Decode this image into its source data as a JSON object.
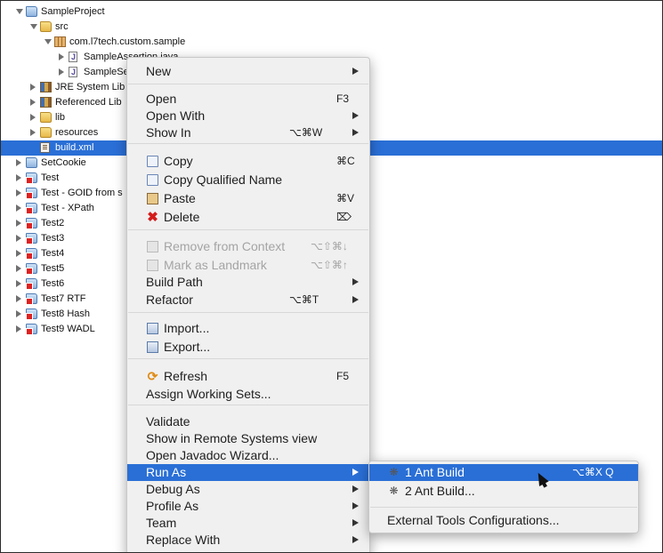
{
  "tree": [
    {
      "label": "SampleProject",
      "toggle": "open",
      "icon": "project-folder-icon"
    },
    {
      "label": "src",
      "toggle": "open",
      "icon": "source-folder-icon"
    },
    {
      "label": "com.l7tech.custom.sample",
      "toggle": "open",
      "icon": "package-icon"
    },
    {
      "label": "SampleAssertion.java",
      "toggle": "closed",
      "icon": "java-file-icon"
    },
    {
      "label": "SampleSe",
      "toggle": "closed",
      "icon": "java-file-icon"
    },
    {
      "label": "JRE System Lib",
      "toggle": "closed",
      "icon": "library-icon"
    },
    {
      "label": "Referenced Lib",
      "toggle": "closed",
      "icon": "library-icon"
    },
    {
      "label": "lib",
      "toggle": "closed",
      "icon": "folder-icon"
    },
    {
      "label": "resources",
      "toggle": "closed",
      "icon": "folder-icon"
    },
    {
      "label": "build.xml",
      "toggle": "none",
      "icon": "xml-file-icon",
      "selected": true
    },
    {
      "label": "SetCookie",
      "toggle": "closed",
      "icon": "project-folder-icon"
    },
    {
      "label": "Test",
      "toggle": "closed",
      "icon": "project-folder-icon",
      "error": true
    },
    {
      "label": "Test - GOID from s",
      "toggle": "closed",
      "icon": "project-folder-icon",
      "error": true
    },
    {
      "label": "Test - XPath",
      "toggle": "closed",
      "icon": "project-folder-icon",
      "error": true
    },
    {
      "label": "Test2",
      "toggle": "closed",
      "icon": "project-folder-icon",
      "error": true
    },
    {
      "label": "Test3",
      "toggle": "closed",
      "icon": "project-folder-icon",
      "error": true
    },
    {
      "label": "Test4",
      "toggle": "closed",
      "icon": "project-folder-icon",
      "error": true
    },
    {
      "label": "Test5",
      "toggle": "closed",
      "icon": "project-folder-icon",
      "error": true
    },
    {
      "label": "Test6",
      "toggle": "closed",
      "icon": "project-folder-icon",
      "error": true
    },
    {
      "label": "Test7 RTF",
      "toggle": "closed",
      "icon": "project-folder-icon",
      "error": true
    },
    {
      "label": "Test8 Hash",
      "toggle": "closed",
      "icon": "project-folder-icon",
      "error": true
    },
    {
      "label": "Test9 WADL",
      "toggle": "closed",
      "icon": "project-folder-icon",
      "error": true
    }
  ],
  "context_menu": {
    "items": [
      {
        "label": "New",
        "submenu": true
      },
      {
        "label": "Open",
        "shortcut": "F3"
      },
      {
        "label": "Open With",
        "submenu": true
      },
      {
        "label": "Show In",
        "shortcut": "⌥⌘W",
        "submenu": true
      },
      {
        "label": "Copy",
        "shortcut": "⌘C",
        "icon": "copy-icon"
      },
      {
        "label": "Copy Qualified Name",
        "icon": "copy-qualified-name-icon"
      },
      {
        "label": "Paste",
        "shortcut": "⌘V",
        "icon": "paste-icon"
      },
      {
        "label": "Delete",
        "shortcut": "⌦",
        "icon": "delete-icon"
      },
      {
        "label": "Remove from Context",
        "shortcut": "⌥⇧⌘↓",
        "icon": "remove-context-icon",
        "disabled": true
      },
      {
        "label": "Mark as Landmark",
        "shortcut": "⌥⇧⌘↑",
        "icon": "landmark-icon",
        "disabled": true
      },
      {
        "label": "Build Path",
        "submenu": true
      },
      {
        "label": "Refactor",
        "shortcut": "⌥⌘T",
        "submenu": true
      },
      {
        "label": "Import...",
        "icon": "import-icon"
      },
      {
        "label": "Export...",
        "icon": "export-icon"
      },
      {
        "label": "Refresh",
        "shortcut": "F5",
        "icon": "refresh-icon"
      },
      {
        "label": "Assign Working Sets..."
      },
      {
        "label": "Validate"
      },
      {
        "label": "Show in Remote Systems view"
      },
      {
        "label": "Open Javadoc Wizard..."
      },
      {
        "label": "Run As",
        "submenu": true,
        "highlighted": true
      },
      {
        "label": "Debug As",
        "submenu": true
      },
      {
        "label": "Profile As",
        "submenu": true
      },
      {
        "label": "Team",
        "submenu": true
      },
      {
        "label": "Replace With",
        "submenu": true
      }
    ]
  },
  "run_as_submenu": {
    "items": [
      {
        "label": "1 Ant Build",
        "shortcut": "⌥⌘X Q",
        "icon": "ant-icon",
        "highlighted": true
      },
      {
        "label": "2 Ant Build...",
        "icon": "ant-icon"
      },
      {
        "label": "External Tools Configurations..."
      }
    ]
  },
  "colors": {
    "selection": "#2a6fd6",
    "menu_background": "#f0f0f0",
    "disabled_text": "#a4a4a4"
  }
}
